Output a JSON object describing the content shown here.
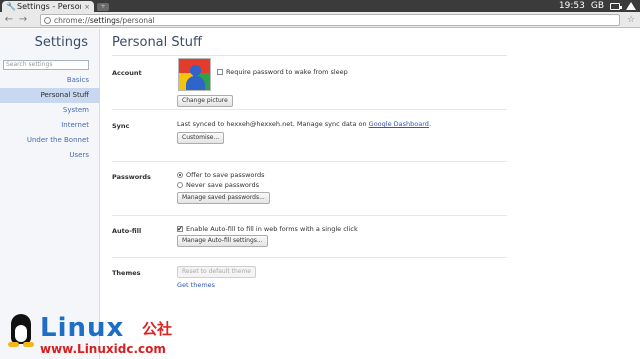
{
  "tab": {
    "title": "Settings - Personal",
    "close_glyph": "×",
    "newtab_glyph": "+"
  },
  "system_tray": {
    "time": "19:53",
    "language": "GB"
  },
  "toolbar": {
    "url_scheme": "chrome://",
    "url_host": "settings",
    "url_path": "/personal",
    "back_glyph": "←",
    "forward_glyph": "→",
    "star_glyph": "☆"
  },
  "sidebar": {
    "heading": "Settings",
    "search_placeholder": "Search settings",
    "items": [
      {
        "label": "Basics",
        "active": false
      },
      {
        "label": "Personal Stuff",
        "active": true
      },
      {
        "label": "System",
        "active": false
      },
      {
        "label": "Internet",
        "active": false
      },
      {
        "label": "Under the Bonnet",
        "active": false
      },
      {
        "label": "Users",
        "active": false
      }
    ]
  },
  "main": {
    "title": "Personal Stuff",
    "account": {
      "label": "Account",
      "require_password_label": "Require password to wake from sleep",
      "require_password_checked": false,
      "change_picture_button": "Change picture"
    },
    "sync": {
      "label": "Sync",
      "status_prefix": "Last synced to hexxeh@hexxeh.net. Manage sync data on ",
      "dashboard_link": "Google Dashboard",
      "status_suffix": ".",
      "customise_button": "Customise..."
    },
    "passwords": {
      "label": "Passwords",
      "offer_label": "Offer to save passwords",
      "never_label": "Never save passwords",
      "selected": "offer",
      "manage_button": "Manage saved passwords..."
    },
    "autofill": {
      "label": "Auto-fill",
      "enable_label": "Enable Auto-fill to fill in web forms with a single click",
      "enable_checked": true,
      "manage_button": "Manage Auto-fill settings..."
    },
    "themes": {
      "label": "Themes",
      "reset_button": "Reset to default theme",
      "get_themes_link": "Get themes"
    }
  },
  "watermark": {
    "brand": "Linux",
    "brand_cn": "公社",
    "url": "www.Linuxidc.com"
  },
  "colors": {
    "accent_link": "#2f57b5",
    "sidebar_active": "#c9d8f1",
    "heading": "#3b4b67"
  }
}
